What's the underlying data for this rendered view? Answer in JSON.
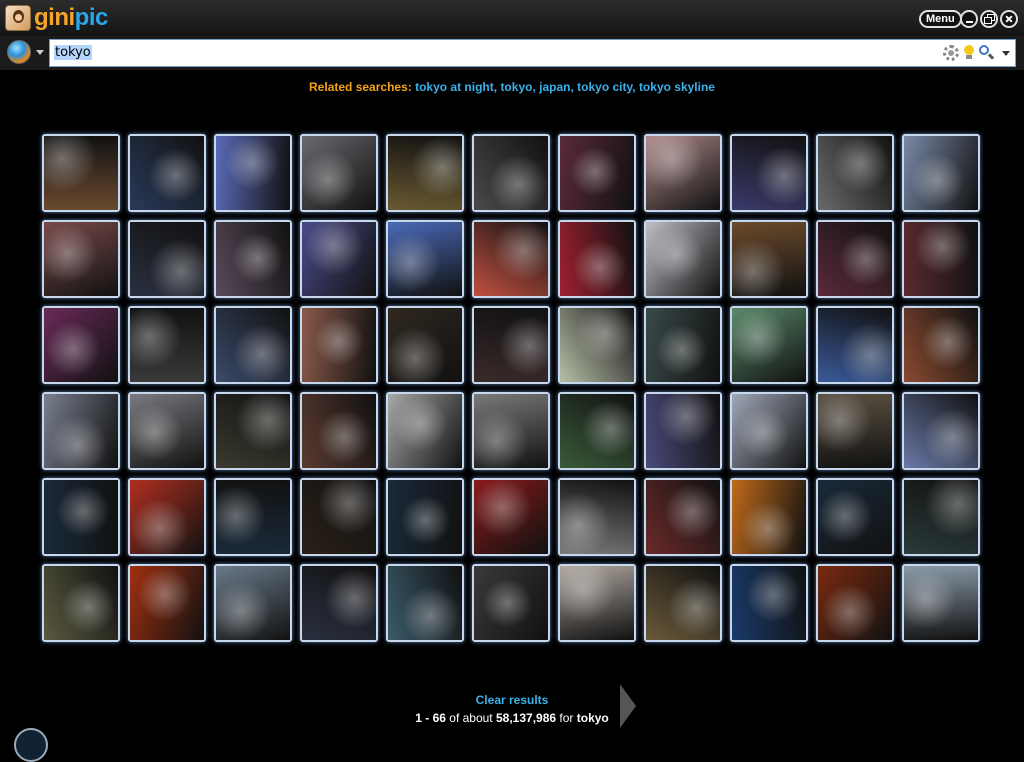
{
  "app": {
    "logo_part1": "gini",
    "logo_part2": "pic",
    "menu_label": "Menu"
  },
  "search": {
    "query": "tokyo"
  },
  "related": {
    "label": "Related searches:",
    "links": [
      "tokyo at night",
      "tokyo",
      "japan",
      "tokyo city",
      "tokyo skyline"
    ]
  },
  "thumbnails": {
    "count": 66,
    "tints": [
      "#6a4a30",
      "#2a3a5a",
      "#5a6ab8",
      "#6a6a70",
      "#6a5a30",
      "#4a4a4a",
      "#5a2a3a",
      "#b08a8a",
      "#3a3a6a",
      "#6a6a6a",
      "#7a8aa8",
      "#7a4a4a",
      "#2a3040",
      "#5a4a5a",
      "#4a4a8a",
      "#4a6ab8",
      "#c05040",
      "#a02030",
      "#c0c0c8",
      "#6a4a2a",
      "#5a2a3a",
      "#5a2a30",
      "#6a2a5a",
      "#3a3a3a",
      "#3a4a6a",
      "#8a5a4a",
      "#302820",
      "#3a2a2a",
      "#b8c0a8",
      "#3a4a4a",
      "#5a8a6a",
      "#3a5a9a",
      "#8a4a30",
      "#7a8090",
      "#7a7a80",
      "#3a3a30",
      "#5a3a30",
      "#a8a8a8",
      "#7a7a78",
      "#3a5a3a",
      "#4a4a7a",
      "#a0a8b8",
      "#5a5040",
      "#6a7aa8",
      "#1a2a3a",
      "#b03020",
      "#1a2a3a",
      "#2a2018",
      "#1a2a3a",
      "#8a1a1a",
      "#7a7a7a",
      "#6a2a2a",
      "#c06a1a",
      "#1a2a3a",
      "#2a3a3a",
      "#5a5a40",
      "#a03010",
      "#6a7a8a",
      "#2a3040",
      "#3a5a6a",
      "#3a3a3a",
      "#b0a8a0",
      "#6a5a3a",
      "#1a3a6a",
      "#7a2a10",
      "#8a9aa8"
    ]
  },
  "footer": {
    "clear_label": "Clear results",
    "range": "1 - 66",
    "of_about": "of about",
    "total": "58,137,986",
    "for_text": "for",
    "query": "tokyo"
  }
}
